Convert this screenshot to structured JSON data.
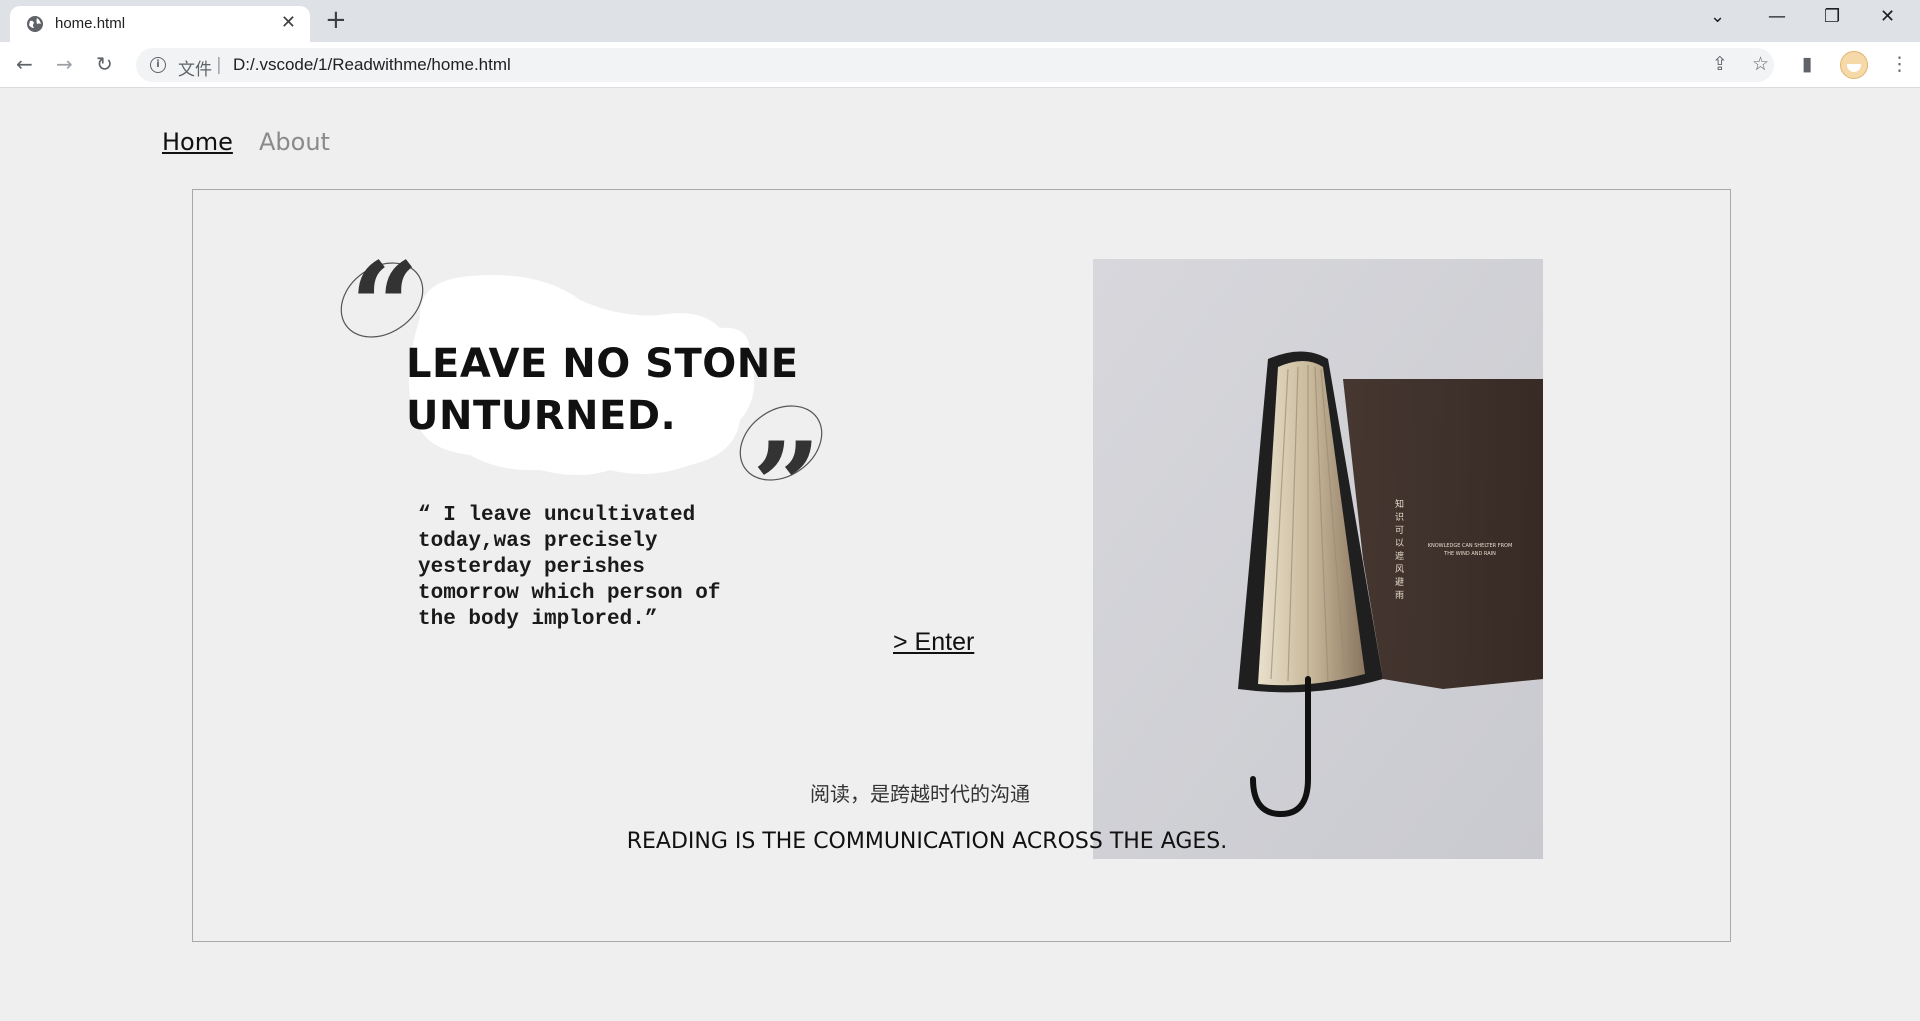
{
  "browser": {
    "tab_title": "home.html",
    "scheme_label": "文件",
    "url": "D:/.vscode/1/Readwithme/home.html"
  },
  "nav": {
    "home": "Home",
    "about": "About"
  },
  "hero": {
    "headline_line1": "LEAVE NO STONE",
    "headline_line2": "UNTURNED.",
    "quote_lines": [
      "“ I leave uncultivated",
      "today,was precisely",
      "yesterday perishes",
      "tomorrow which person of",
      "the body implored.”"
    ],
    "enter_link": "> Enter"
  },
  "photo": {
    "vertical_text": "知识可以遮风避雨",
    "small_text_line1": "KNOWLEDGE CAN SHELTER FROM",
    "small_text_line2": "THE WIND AND RAIN"
  },
  "captions": {
    "cn": "阅读，是跨越时代的沟通",
    "en": "READING IS THE COMMUNICATION ACROSS THE AGES."
  },
  "icons": {
    "favicon": "globe-icon",
    "info": "info-icon",
    "share": "share-icon",
    "bookmark": "star-icon",
    "sidepanel": "side-panel-icon",
    "menu": "kebab-menu-icon"
  }
}
